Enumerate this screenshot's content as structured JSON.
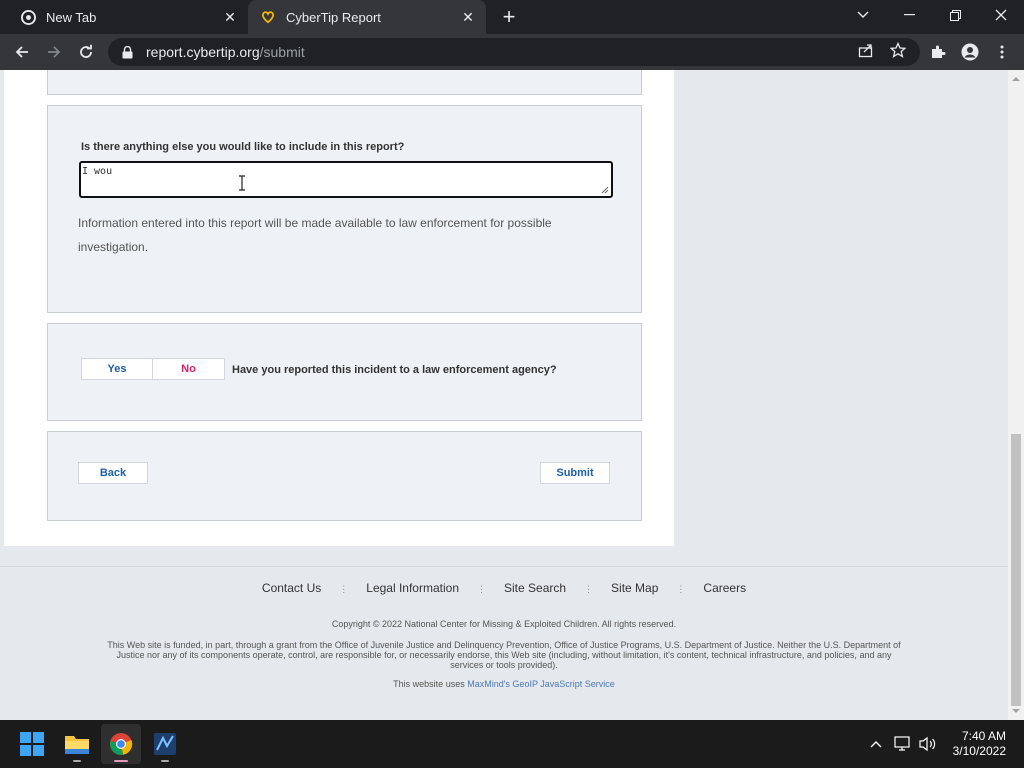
{
  "browser": {
    "tabs": [
      {
        "title": "New Tab",
        "active": false,
        "icon": "chrome-icon"
      },
      {
        "title": "CyberTip Report",
        "active": true,
        "icon": "cybertip-heart-icon"
      }
    ],
    "url_host": "report.cybertip.org",
    "url_path": "/submit"
  },
  "form": {
    "additional_info": {
      "label": "Is there anything else you would like to include in this report?",
      "value": "I wou"
    },
    "notice": "Information entered into this report will be made available to law enforcement for possible investigation.",
    "reported": {
      "yes_label": "Yes",
      "no_label": "No",
      "question": "Have you reported this incident to a law enforcement agency?"
    },
    "back_label": "Back",
    "submit_label": "Submit"
  },
  "footer": {
    "links": [
      "Contact Us",
      "Legal Information",
      "Site Search",
      "Site Map",
      "Careers"
    ],
    "copyright": "Copyright © 2022 National Center for Missing & Exploited Children. All rights reserved.",
    "disclaimer": "This Web site is funded, in part, through a grant from the Office of Juvenile Justice and Delinquency Prevention, Office of Justice Programs, U.S. Department of Justice. Neither the U.S. Department of Justice nor any of its components operate, control, are responsible for, or necessarily endorse, this Web site (including, without limitation, it's content, technical infrastructure, and policies, and any services or tools provided).",
    "geoip_prefix": "This website uses ",
    "geoip_link": "MaxMind's GeoIP JavaScript Service"
  },
  "taskbar": {
    "apps": [
      "windows-start-icon",
      "file-explorer-icon",
      "chrome-icon",
      "app-icon"
    ],
    "time": "7:40 AM",
    "date": "3/10/2022"
  },
  "colors": {
    "accent_blue": "#1f5fa8",
    "no_pink": "#d42267",
    "panel_bg": "#eef1f6"
  }
}
